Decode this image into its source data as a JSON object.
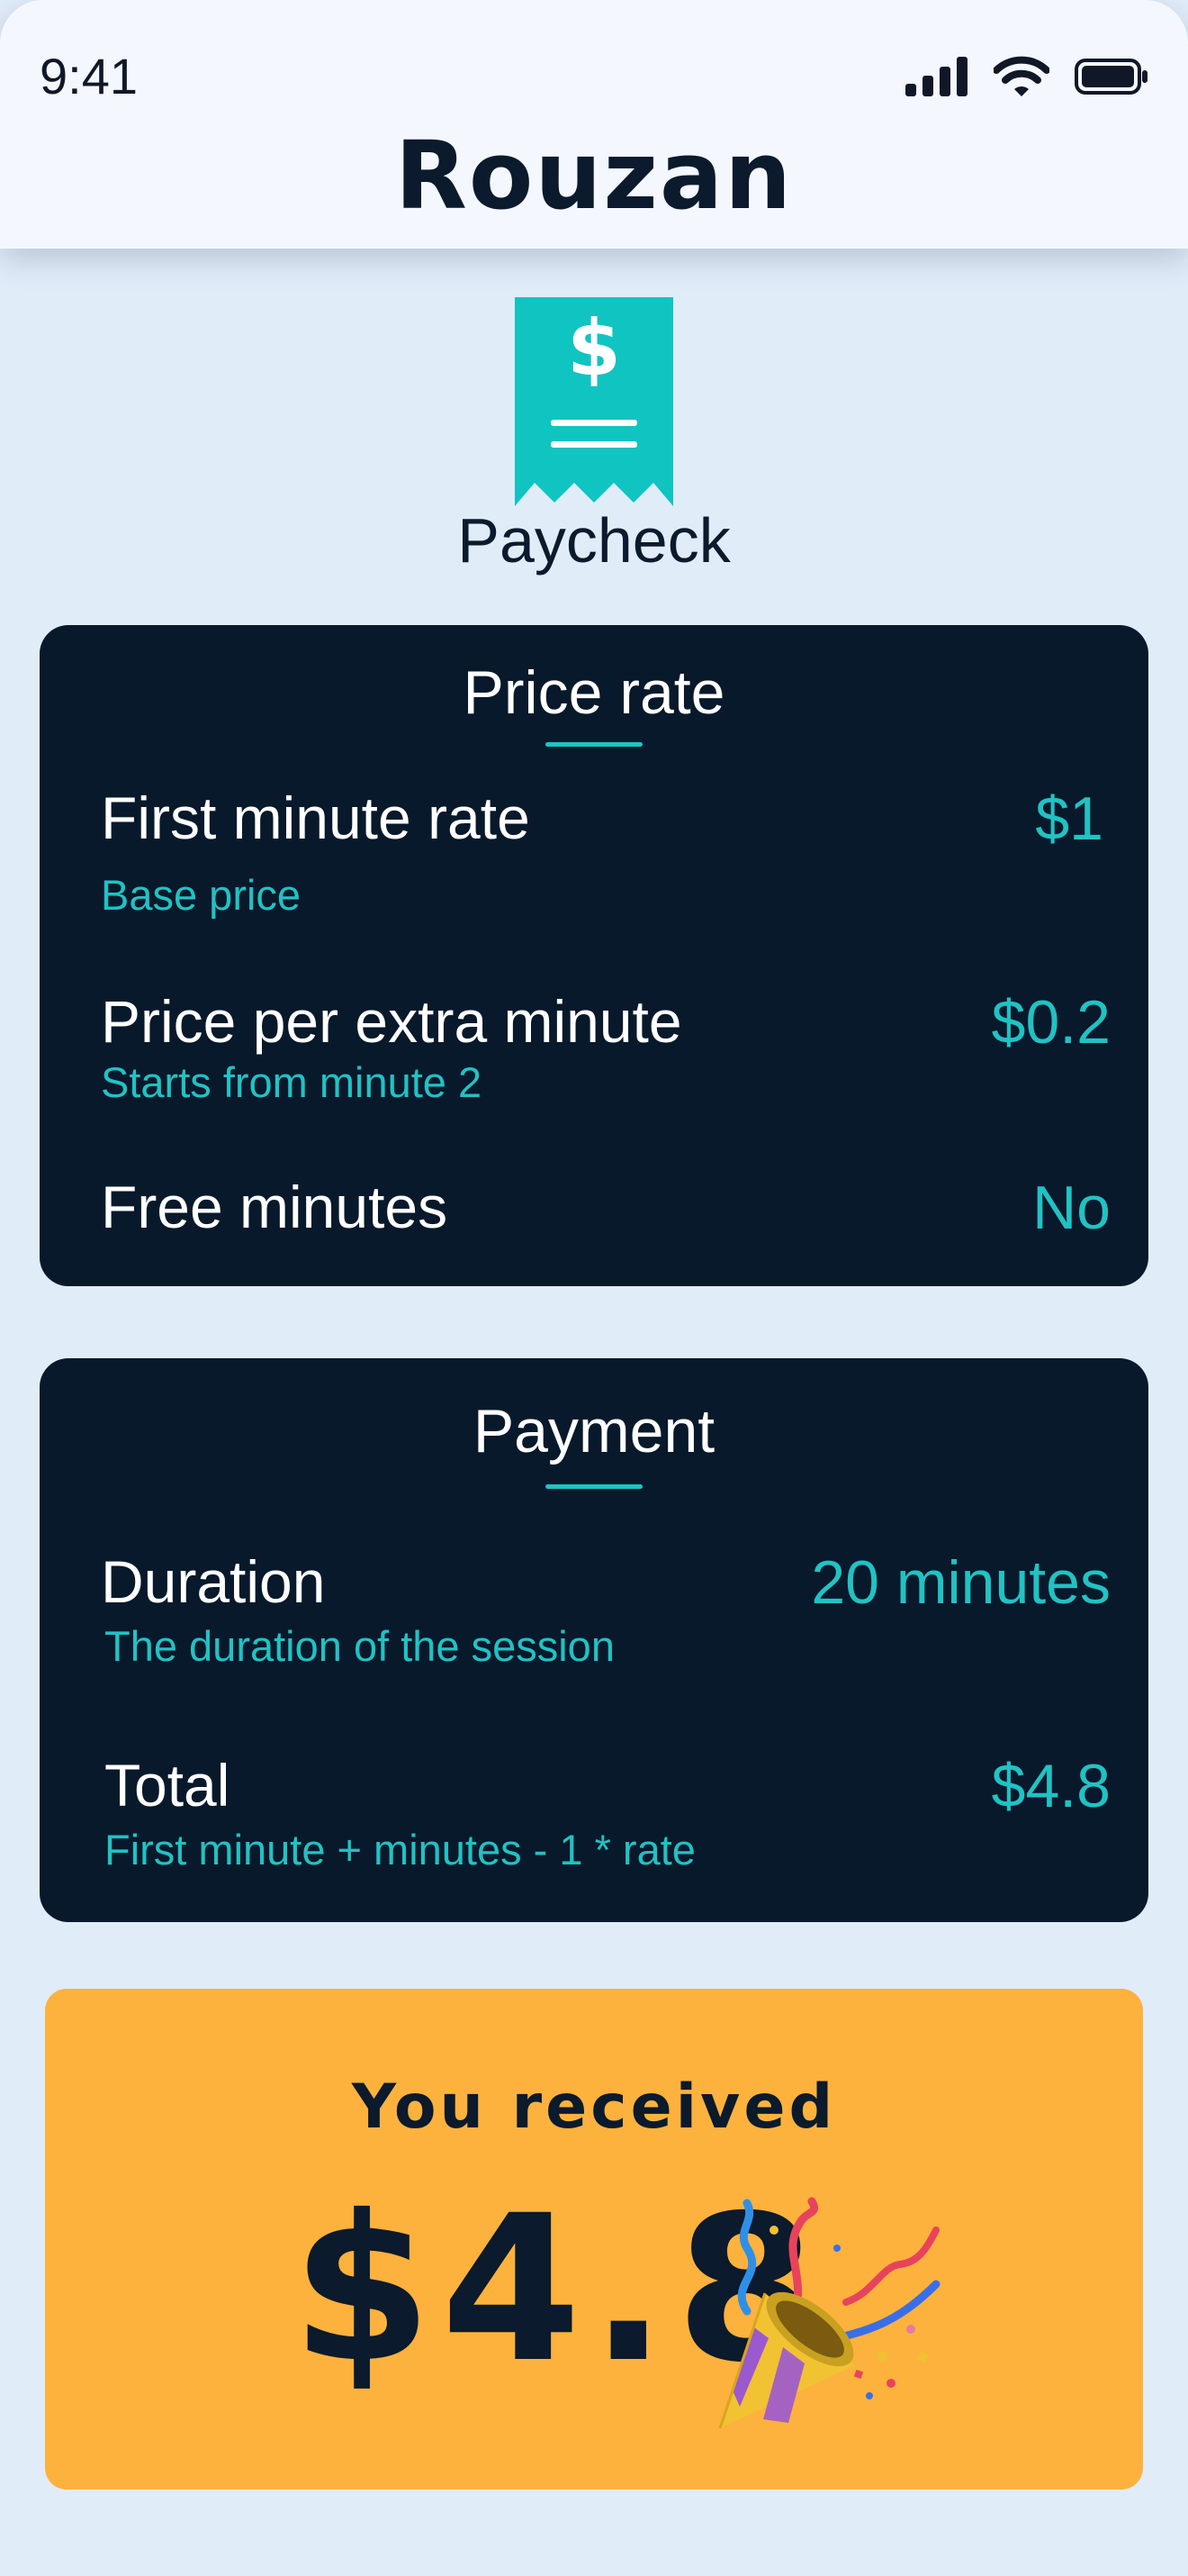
{
  "status_bar": {
    "time": "9:41",
    "icons": [
      "cellular-signal-icon",
      "wifi-icon",
      "battery-icon"
    ]
  },
  "header": {
    "app_name": "Rouzan"
  },
  "hero": {
    "icon": "receipt-dollar-icon",
    "title": "Paycheck"
  },
  "price_rate": {
    "title": "Price rate",
    "rows": [
      {
        "label": "First minute rate",
        "sub": "Base price",
        "value": "$1"
      },
      {
        "label": "Price per extra minute",
        "sub": "Starts from minute 2",
        "value": "$0.2"
      },
      {
        "label": "Free minutes",
        "value": "No"
      }
    ]
  },
  "payment": {
    "title": "Payment",
    "rows": [
      {
        "label": "Duration",
        "sub": "The duration of the session",
        "value": "20 minutes"
      },
      {
        "label": "Total",
        "sub": "First minute + minutes - 1 * rate",
        "value": "$4.8"
      }
    ]
  },
  "received": {
    "label": "You received",
    "amount": "$4.8",
    "icon": "party-popper-icon"
  },
  "colors": {
    "background": "#e1ecf9",
    "card": "#08192b",
    "accent_teal": "#21c2c3",
    "receipt_teal": "#10c4c2",
    "banner_orange": "#fdb23d",
    "text_dark": "#0b1a2c"
  }
}
